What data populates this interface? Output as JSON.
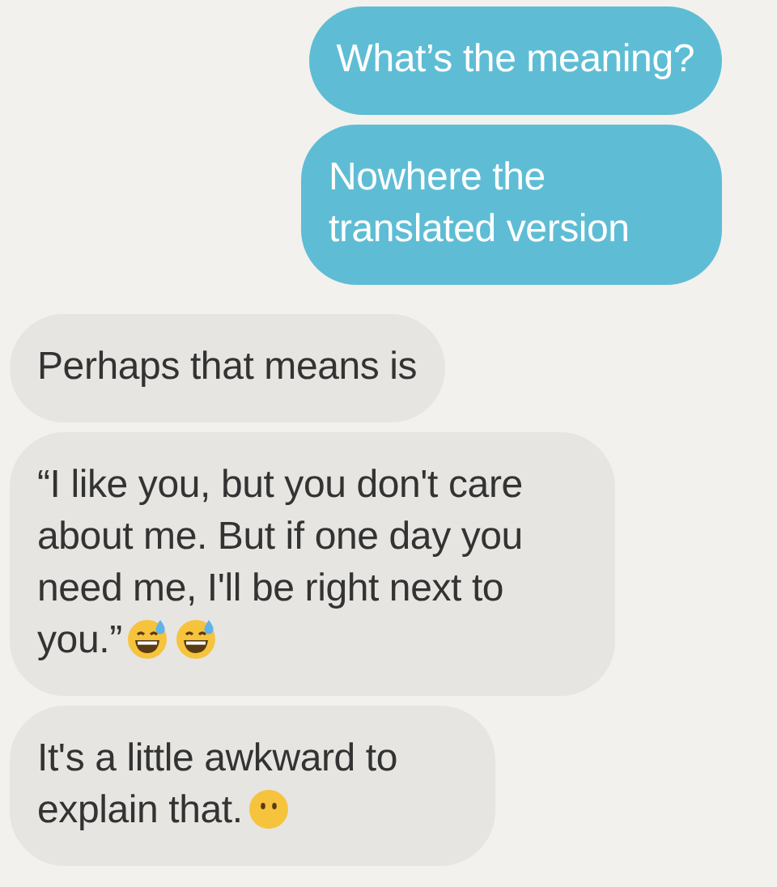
{
  "messages": [
    {
      "kind": "outgoing",
      "text": "What’s the meaning?"
    },
    {
      "kind": "outgoing",
      "text": "Nowhere the translated version"
    },
    {
      "kind": "incoming",
      "text": "Perhaps that means is"
    },
    {
      "kind": "incoming",
      "text": "“I like you, but you don't care about me. But if one day you need me, I'll be right next to you.”",
      "emojis": [
        {
          "kind": "sweat-smile"
        },
        {
          "kind": "sweat-smile"
        }
      ]
    },
    {
      "kind": "incoming",
      "text": "It's a little awkward to explain that.",
      "emojis": [
        {
          "kind": "no-mouth"
        }
      ]
    }
  ]
}
